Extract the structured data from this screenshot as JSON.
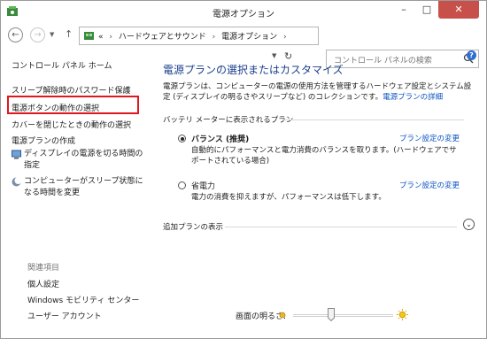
{
  "window": {
    "title": "電源オプション",
    "controls": {
      "minimize": "–",
      "maximize": "□",
      "close": "✕"
    }
  },
  "navigation": {
    "back_icon": "back-arrow-icon",
    "forward_icon": "forward-arrow-icon",
    "up_icon": "up-arrow-icon",
    "address": {
      "prefix": "«",
      "segments": [
        "ハードウェアとサウンド",
        "電源オプション"
      ],
      "separator": "›"
    },
    "search_placeholder": "コントロール パネルの検索"
  },
  "sidebar": {
    "home": "コントロール パネル ホーム",
    "items": [
      {
        "label": "スリープ解除時のパスワード保護"
      },
      {
        "label": "電源ボタンの動作の選択"
      },
      {
        "label": "カバーを閉じたときの動作の選択"
      },
      {
        "label": "電源プランの作成"
      },
      {
        "label": "ディスプレイの電源を切る時間の指定",
        "icon": "display-icon"
      },
      {
        "label": "コンピューターがスリープ状態になる時間を変更",
        "icon": "moon-icon"
      }
    ],
    "see_also": {
      "heading": "関連項目",
      "items": [
        "個人設定",
        "Windows モビリティ センター",
        "ユーザー アカウント"
      ]
    }
  },
  "main": {
    "title": "電源プランの選択またはカスタマイズ",
    "description": "電源プランは、コンピューターの電源の使用方法を管理するハードウェア設定とシステム設定 (ディスプレイの明るさやスリープなど) のコレクションです。",
    "description_link": "電源プランの詳細",
    "group_label": "バッテリ メーターに表示されるプラン",
    "plans": [
      {
        "name": "バランス (推奨)",
        "selected": true,
        "description": "自動的にパフォーマンスと電力消費のバランスを取ります。(ハードウェアでサポートされている場合)",
        "link": "プラン設定の変更"
      },
      {
        "name": "省電力",
        "selected": false,
        "description": "電力の消費を抑えますが、パフォーマンスは低下します。",
        "link": "プラン設定の変更"
      }
    ],
    "extra_plans_label": "追加プランの表示",
    "brightness_label": "画面の明るさ:",
    "brightness_level": 0.38
  },
  "colors": {
    "title_blue": "#1a3e8c",
    "link_blue": "#0a54c2",
    "highlight_red": "#e0181e",
    "close_red": "#c7504b"
  }
}
